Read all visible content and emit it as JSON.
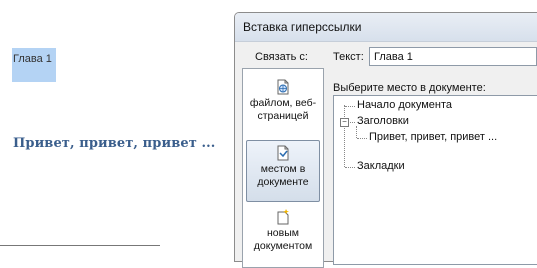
{
  "document": {
    "selected_heading": "Глава 1",
    "body_text": "Привет, привет, привет ..."
  },
  "dialog": {
    "title": "Вставка гиперссылки",
    "link_to_label": "Связать с:",
    "text_label": "Текст:",
    "text_value": "Глава 1",
    "place_label": "Выберите место в документе:",
    "link_options": [
      {
        "label_line1": "файлом, веб-",
        "label_line2": "страницей",
        "icon": "web-page-icon"
      },
      {
        "label_line1": "местом в",
        "label_line2": "документе",
        "icon": "place-in-document-icon"
      },
      {
        "label_line1": "новым",
        "label_line2": "документом",
        "icon": "new-document-icon"
      }
    ],
    "tree": {
      "start": "Начало документа",
      "headings": "Заголовки",
      "heading_item": "Привет, привет, привет ...",
      "bookmarks": "Закладки",
      "headings_expander": "−"
    }
  },
  "colors": {
    "selection": "#b4d3f4",
    "heading_text": "#3a5e8c"
  }
}
